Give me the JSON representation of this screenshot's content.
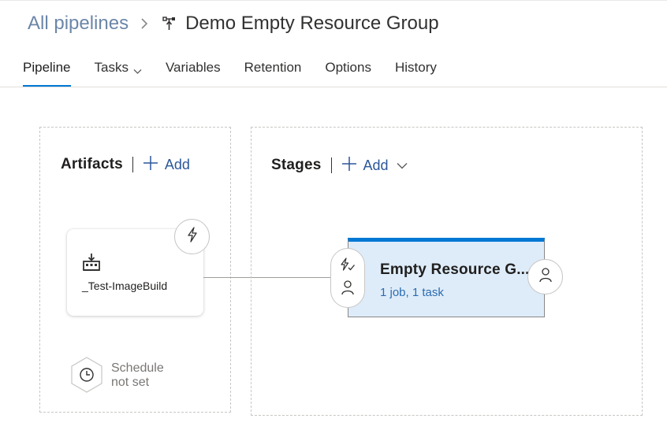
{
  "breadcrumb": {
    "all_pipelines": "All pipelines",
    "separator_icon": "chevron-right-icon",
    "pipeline_icon": "release-pipeline-icon",
    "title": "Demo Empty Resource Group"
  },
  "tabs": [
    {
      "label": "Pipeline",
      "active": true
    },
    {
      "label": "Tasks",
      "has_dropdown": true
    },
    {
      "label": "Variables"
    },
    {
      "label": "Retention"
    },
    {
      "label": "Options"
    },
    {
      "label": "History"
    }
  ],
  "artifacts": {
    "title": "Artifacts",
    "add_label": "Add",
    "items": [
      {
        "name": "_Test-ImageBuild",
        "icon": "build-artifact-icon",
        "trigger_icon": "lightning-icon"
      }
    ],
    "schedule": {
      "line1": "Schedule",
      "line2": "not set",
      "icon": "clock-icon"
    }
  },
  "stages": {
    "title": "Stages",
    "add_label": "Add",
    "items": [
      {
        "name": "Empty Resource G...",
        "summary": "1 job, 1 task",
        "pre_icons": [
          "lightning-check-icon",
          "person-icon"
        ],
        "post_icon": "person-icon"
      }
    ]
  },
  "colors": {
    "accent": "#0078d4",
    "link": "#2b579a",
    "stage_bg": "#deecf9"
  }
}
